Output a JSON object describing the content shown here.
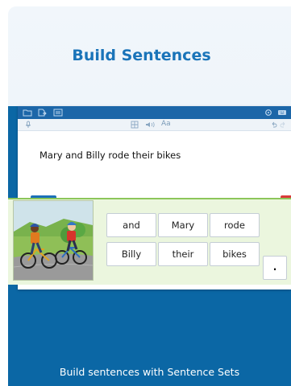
{
  "hero": {
    "title": "Build Sentences"
  },
  "caption": "Build sentences with Sentence Sets",
  "app": {
    "toolbar": {
      "font_label": "Aa"
    },
    "sentence": "Mary and Billy rode their bikes",
    "go_button_glyph": "→"
  },
  "word_tiles": [
    "and",
    "Mary",
    "rode",
    "Billy",
    "their",
    "bikes"
  ],
  "punctuation_tile": ".",
  "colors": {
    "title_blue": "#1a74b9",
    "panel_blue": "#0b67a5",
    "titlebar_blue": "#1c66a8",
    "tray_green": "#ebf6de",
    "delete_red": "#d93a3a"
  },
  "icons": [
    "folder-icon",
    "export-icon",
    "image-icon",
    "settings-icon",
    "keyboard-icon",
    "microphone-icon",
    "grid-icon",
    "speaker-icon",
    "undo-icon",
    "redo-icon",
    "arrow-right-icon",
    "delete-icon"
  ]
}
